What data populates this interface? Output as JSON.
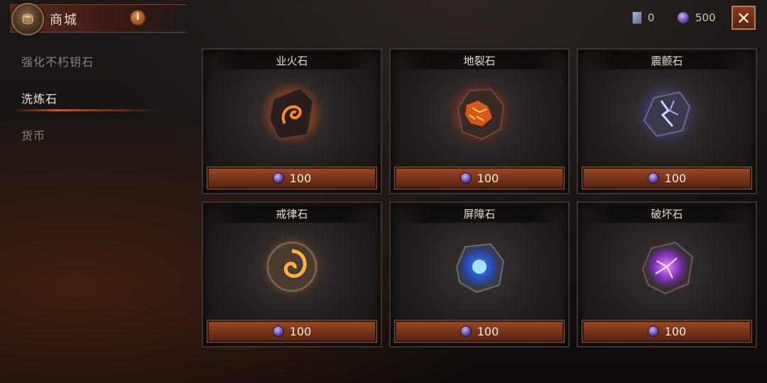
{
  "header": {
    "shop_icon": "coin-pouch-icon",
    "title": "商城",
    "info_label": "i",
    "close_label": "✕"
  },
  "currencies": {
    "ticket": {
      "icon": "ticket-icon",
      "value": "0"
    },
    "gem": {
      "icon": "purple-gem-icon",
      "value": "500"
    }
  },
  "sidebar": {
    "items": [
      {
        "label": "强化不朽钥石",
        "active": false
      },
      {
        "label": "洗炼石",
        "active": true
      },
      {
        "label": "货币",
        "active": false
      }
    ]
  },
  "shop": {
    "items": [
      {
        "name": "业火石",
        "price": "100",
        "icon": "fire-stone-icon",
        "glow": "#ff6a1a"
      },
      {
        "name": "地裂石",
        "price": "100",
        "icon": "lava-stone-icon",
        "glow": "#ff4a10"
      },
      {
        "name": "震颤石",
        "price": "100",
        "icon": "lightning-stone-icon",
        "glow": "#7a7aff"
      },
      {
        "name": "戒律石",
        "price": "100",
        "icon": "spiral-stone-icon",
        "glow": "#ffb040"
      },
      {
        "name": "屏障石",
        "price": "100",
        "icon": "barrier-stone-icon",
        "glow": "#2a8aff"
      },
      {
        "name": "破坏石",
        "price": "100",
        "icon": "destruction-stone-icon",
        "glow": "#c04aff"
      }
    ]
  }
}
